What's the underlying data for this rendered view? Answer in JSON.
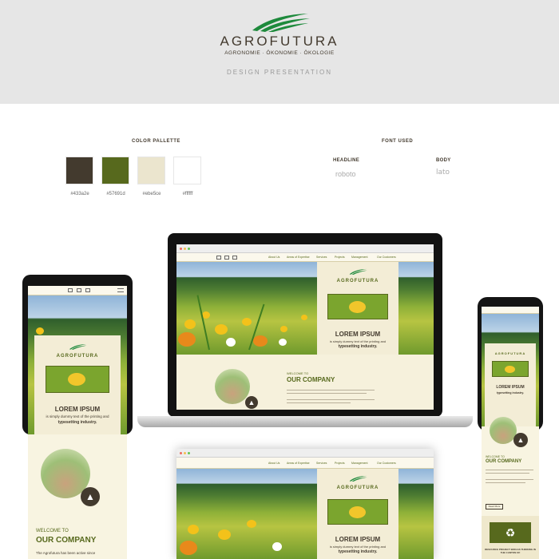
{
  "header": {
    "brand_name": "AGROFUTURA",
    "brand_tagline": "AGRONOMIE · ÖKONOMIE · ÖKOLOGIE",
    "subtitle": "DESIGN PRESENTATION",
    "brand_color": "#1e8a3c"
  },
  "palette": {
    "title": "COLOR PALLETTE",
    "colors": [
      {
        "hex": "#433a2e",
        "label": "#433a2e"
      },
      {
        "hex": "#57691d",
        "label": "#57691d"
      },
      {
        "hex": "#ebe5ce",
        "label": "#ebe5ce"
      },
      {
        "hex": "#ffffff",
        "label": "#ffffff"
      }
    ]
  },
  "fonts": {
    "title": "FONT USED",
    "headline_label": "HEADLINE",
    "headline_font": "roboto",
    "body_label": "BODY",
    "body_font": "lato"
  },
  "mockup": {
    "nav_items": [
      "About Us",
      "Areas of Expertise",
      "Services",
      "Projects",
      "Management",
      "Our Customers"
    ],
    "hero_title": "LOREM IPSUM",
    "hero_text_1": "is simply dummy text of the printing and",
    "hero_text_2": "typesetting industry.",
    "welcome": "WELCOME TO",
    "company": "OUR COMPANY",
    "body_intro": "The Agrofutura has been active since",
    "read_more": "Read More",
    "project_heading": "RESOURCE PROJECT BIOGAS THINKING IN THE CANTON OF"
  }
}
